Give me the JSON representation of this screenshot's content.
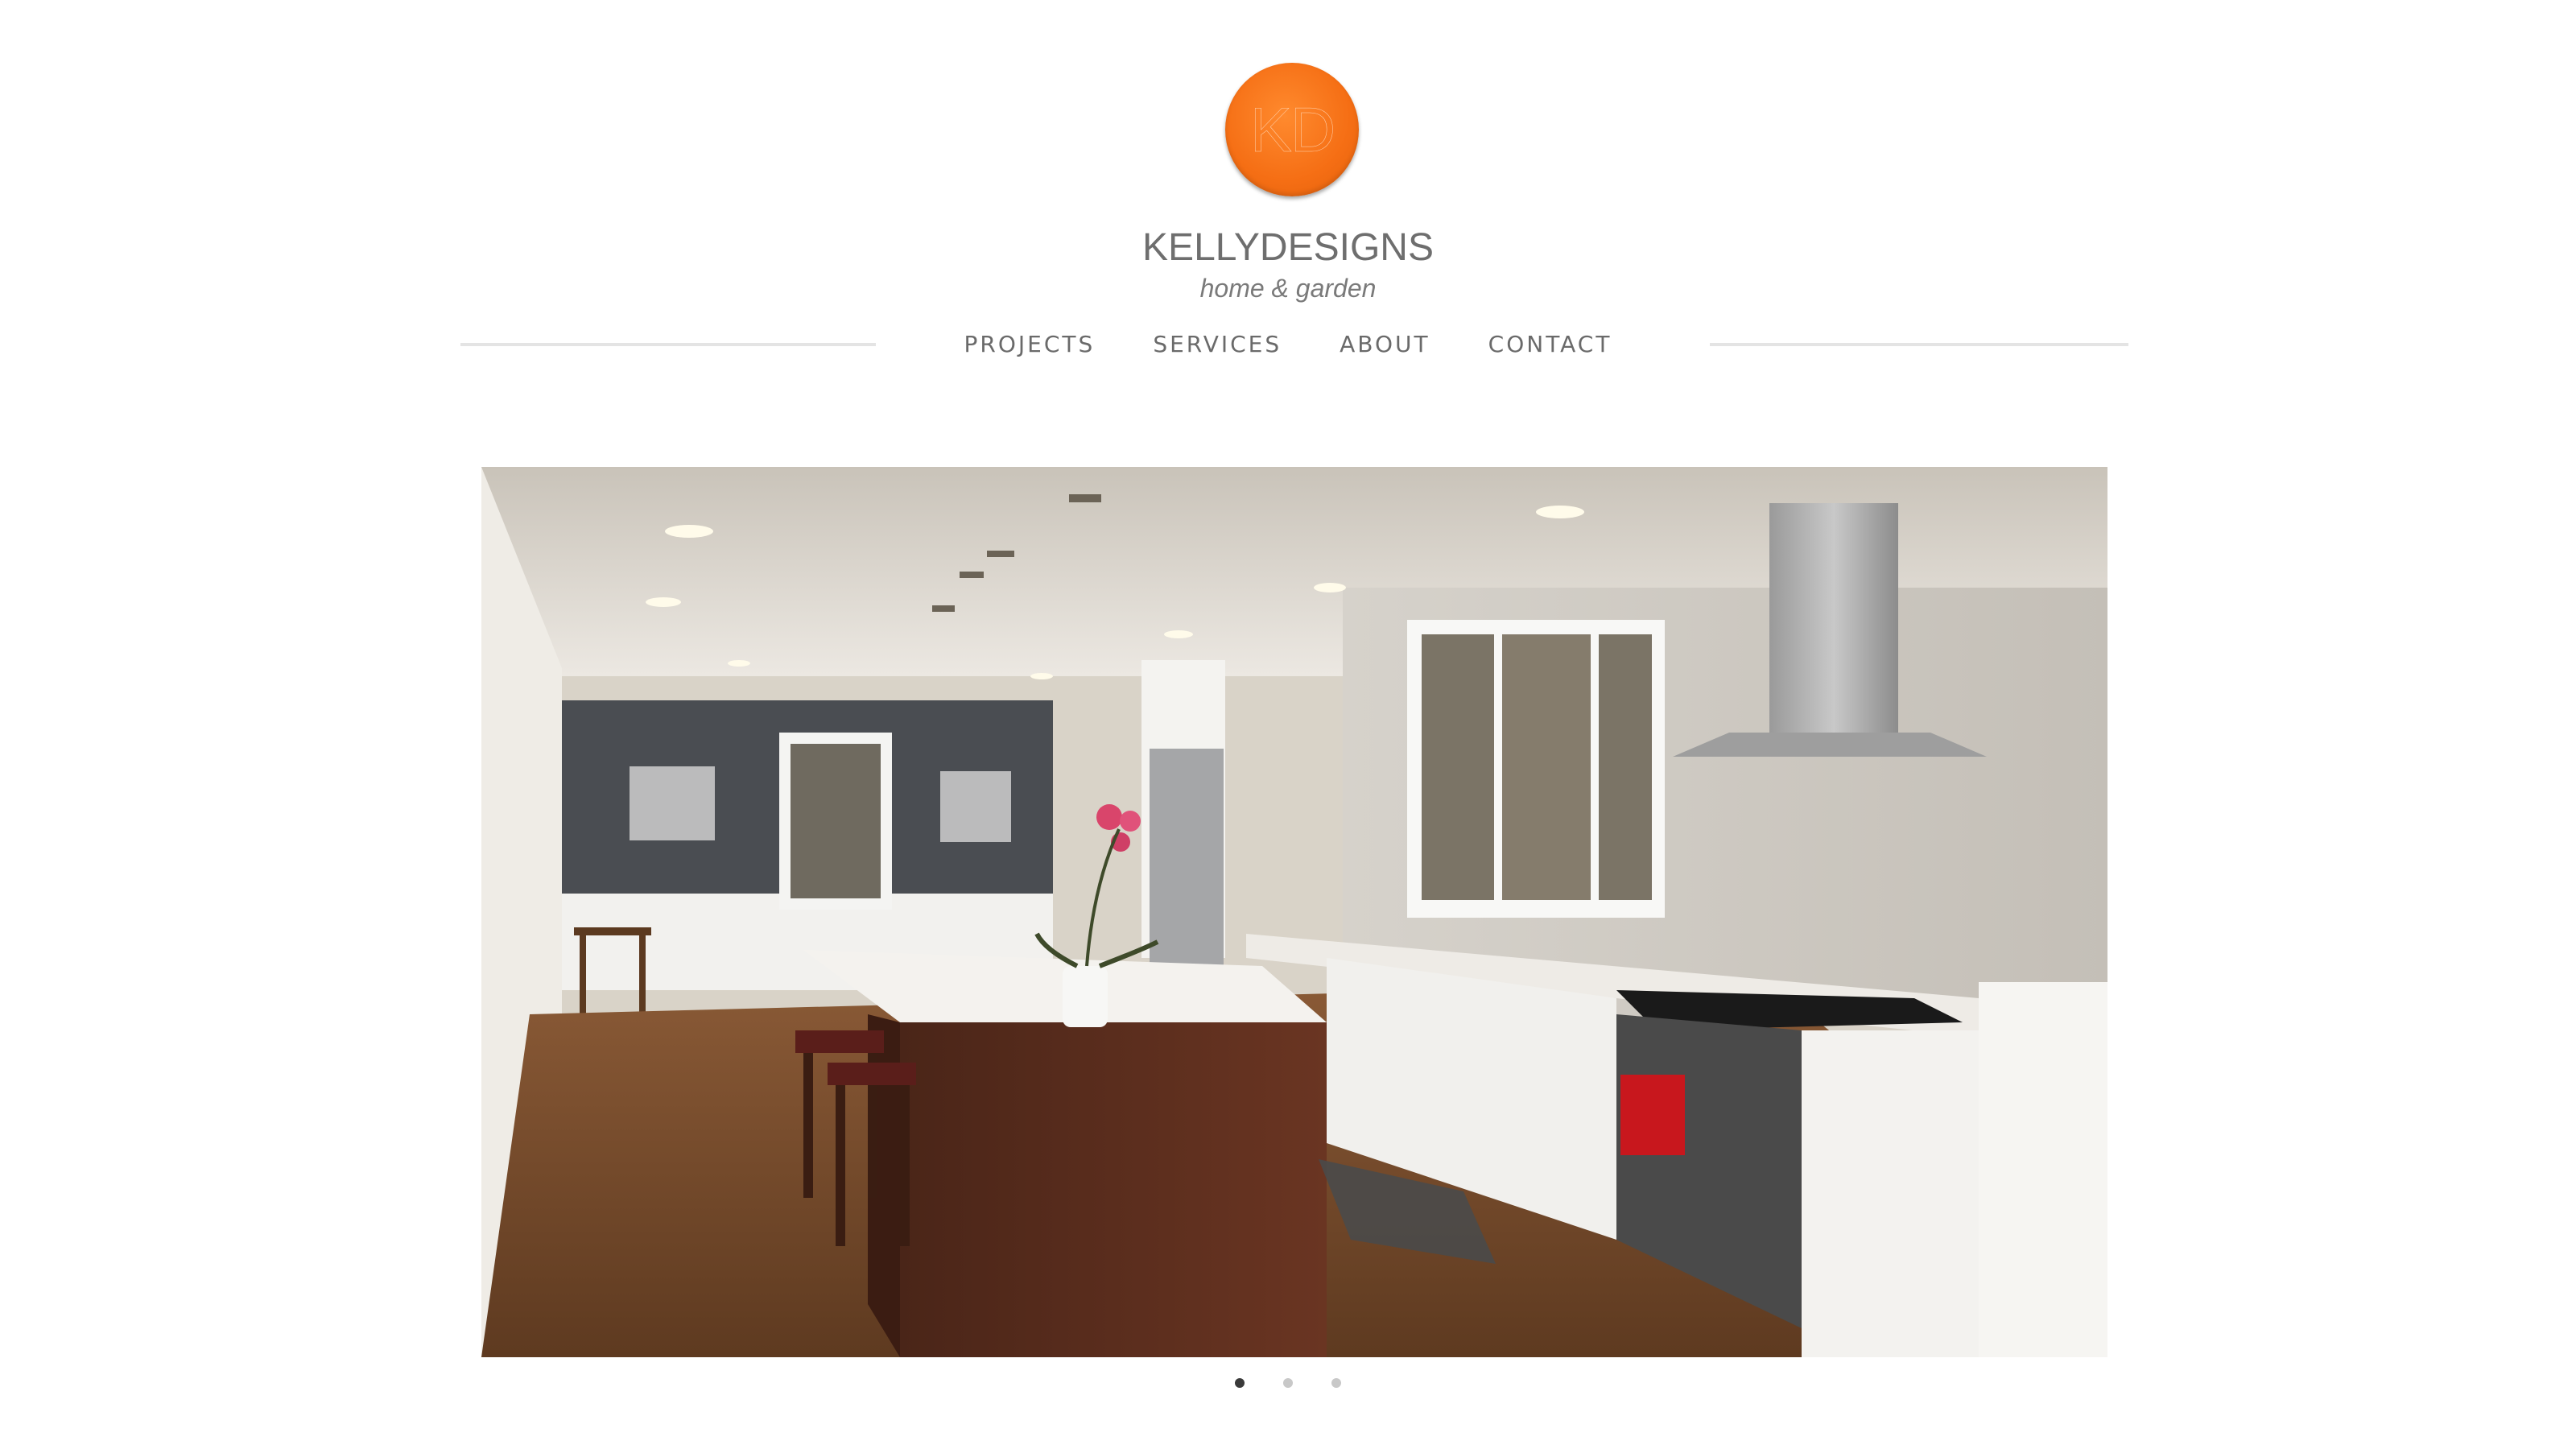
{
  "logo": {
    "monogram": "KD",
    "accent_color": "#f56e14"
  },
  "brand": {
    "name": "KELLYDESIGNS",
    "tagline": "home & garden"
  },
  "nav": {
    "items": [
      {
        "label": "PROJECTS"
      },
      {
        "label": "SERVICES"
      },
      {
        "label": "ABOUT"
      },
      {
        "label": "CONTACT"
      }
    ]
  },
  "slideshow": {
    "total_slides": 3,
    "active_slide": 1
  }
}
